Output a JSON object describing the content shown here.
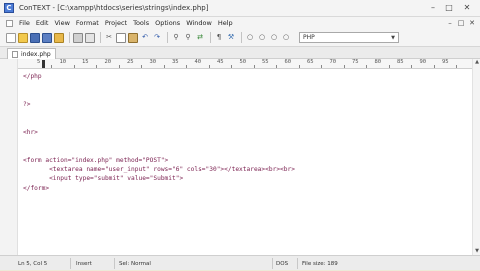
{
  "window": {
    "title": "ConTEXT - [C:\\xampp\\htdocs\\series\\strings\\index.php]"
  },
  "menu": {
    "items": [
      "File",
      "Edit",
      "View",
      "Format",
      "Project",
      "Tools",
      "Options",
      "Window",
      "Help"
    ]
  },
  "toolbar": {
    "language_value": "PHP"
  },
  "tabs": [
    {
      "label": "index.php"
    }
  ],
  "ruler": {
    "labels": [
      "5",
      "10",
      "15",
      "20",
      "25",
      "30",
      "35",
      "40",
      "45",
      "50",
      "55",
      "60",
      "65",
      "70",
      "75",
      "80",
      "85",
      "90",
      "95"
    ]
  },
  "editor": {
    "lines": [
      "</php",
      "",
      "",
      "?>",
      "",
      "",
      "<hr>",
      "",
      "",
      "<form action=\"index.php\" method=\"POST\">",
      "       <textarea name=\"user_input\" rows=\"6\" cols=\"30\"></textarea><br><br>",
      "       <input type=\"submit\" value=\"Submit\">",
      "</form>"
    ]
  },
  "status": {
    "position": "Ln 5, Col 5",
    "mode": "Insert",
    "selection": "Sel: Normal",
    "format": "DOS",
    "file_size": "File size: 189"
  }
}
